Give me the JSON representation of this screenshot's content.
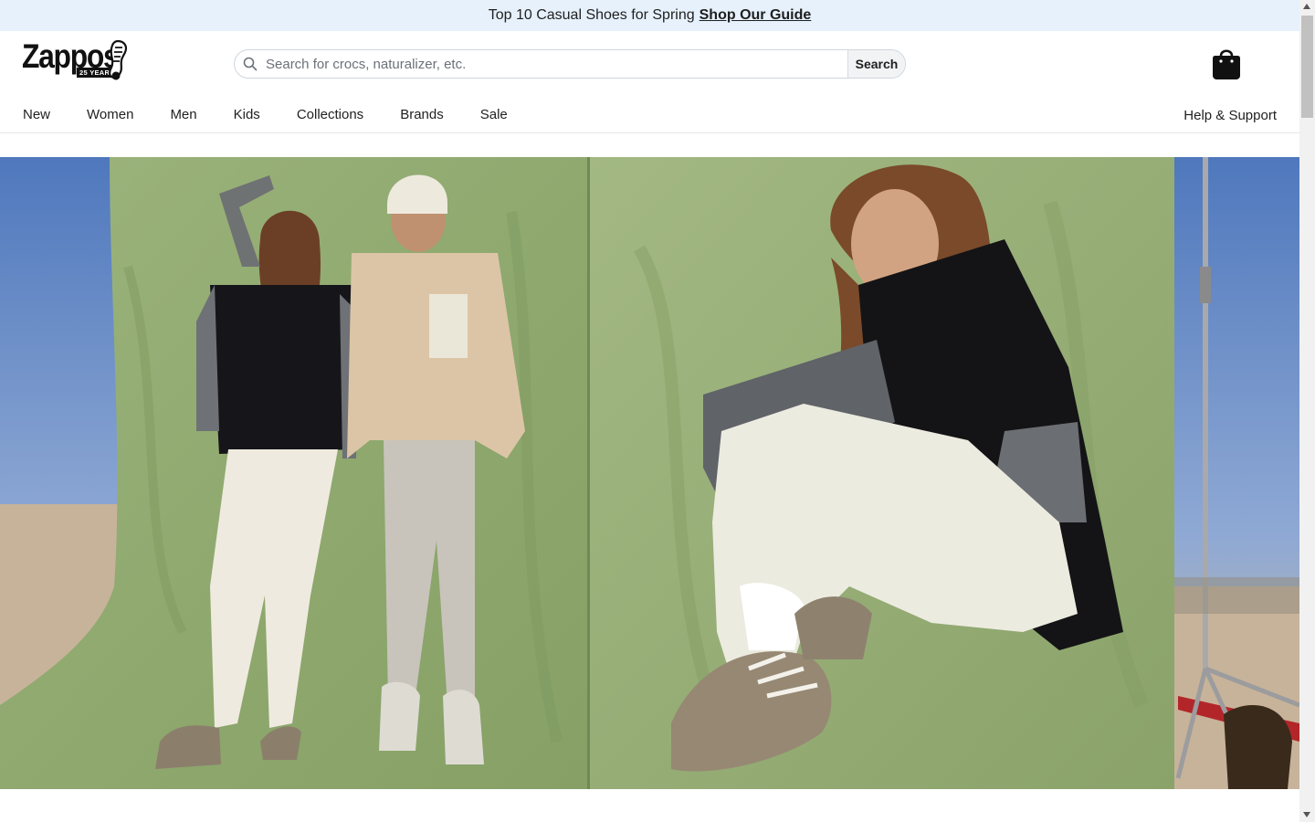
{
  "promo": {
    "text": "Top 10 Casual Shoes for Spring",
    "link": "Shop Our Guide"
  },
  "header": {
    "logo_text": "Zappos",
    "logo_badge": "25 YEARS",
    "search_placeholder": "Search for crocs, naturalizer, etc.",
    "search_button": "Search",
    "bag_icon": "shopping-bag-icon"
  },
  "nav": {
    "items": [
      "New",
      "Women",
      "Men",
      "Kids",
      "Collections",
      "Brands",
      "Sale"
    ],
    "help": "Help & Support"
  },
  "colors": {
    "promo_bg": "#e6f1fc",
    "backdrop_green": "#93ad74",
    "sky_blue": "#5f86c4",
    "text": "#1f1f1f"
  }
}
